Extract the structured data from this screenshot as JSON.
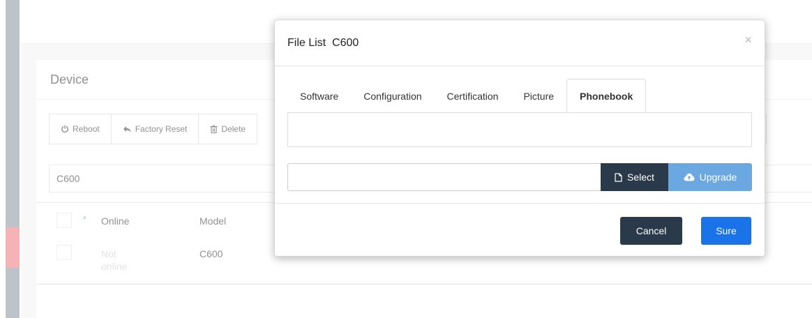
{
  "background": {
    "panel_title": "Device",
    "toolbar": [
      {
        "label": "Reboot",
        "icon": "power-icon"
      },
      {
        "label": "Factory Reset",
        "icon": "reply-icon"
      },
      {
        "label": "Delete",
        "icon": "trash-icon"
      }
    ],
    "filter_value": "C600",
    "table": {
      "columns": [
        "Online",
        "Model"
      ],
      "rows": [
        {
          "online_line1": "Not",
          "online_line2": "online",
          "model": "C600"
        }
      ]
    }
  },
  "modal": {
    "title": "File List  C600",
    "close_symbol": "×",
    "tabs": [
      "Software",
      "Configuration",
      "Certification",
      "Picture",
      "Phonebook"
    ],
    "active_tab": "Phonebook",
    "select_label": "Select",
    "upgrade_label": "Upgrade",
    "cancel_label": "Cancel",
    "sure_label": "Sure"
  },
  "colors": {
    "dark_button": "#2b3a4a",
    "upgrade_button": "#6ba7e0",
    "primary_button": "#1a73e8",
    "rail_active": "#f08a8e"
  }
}
